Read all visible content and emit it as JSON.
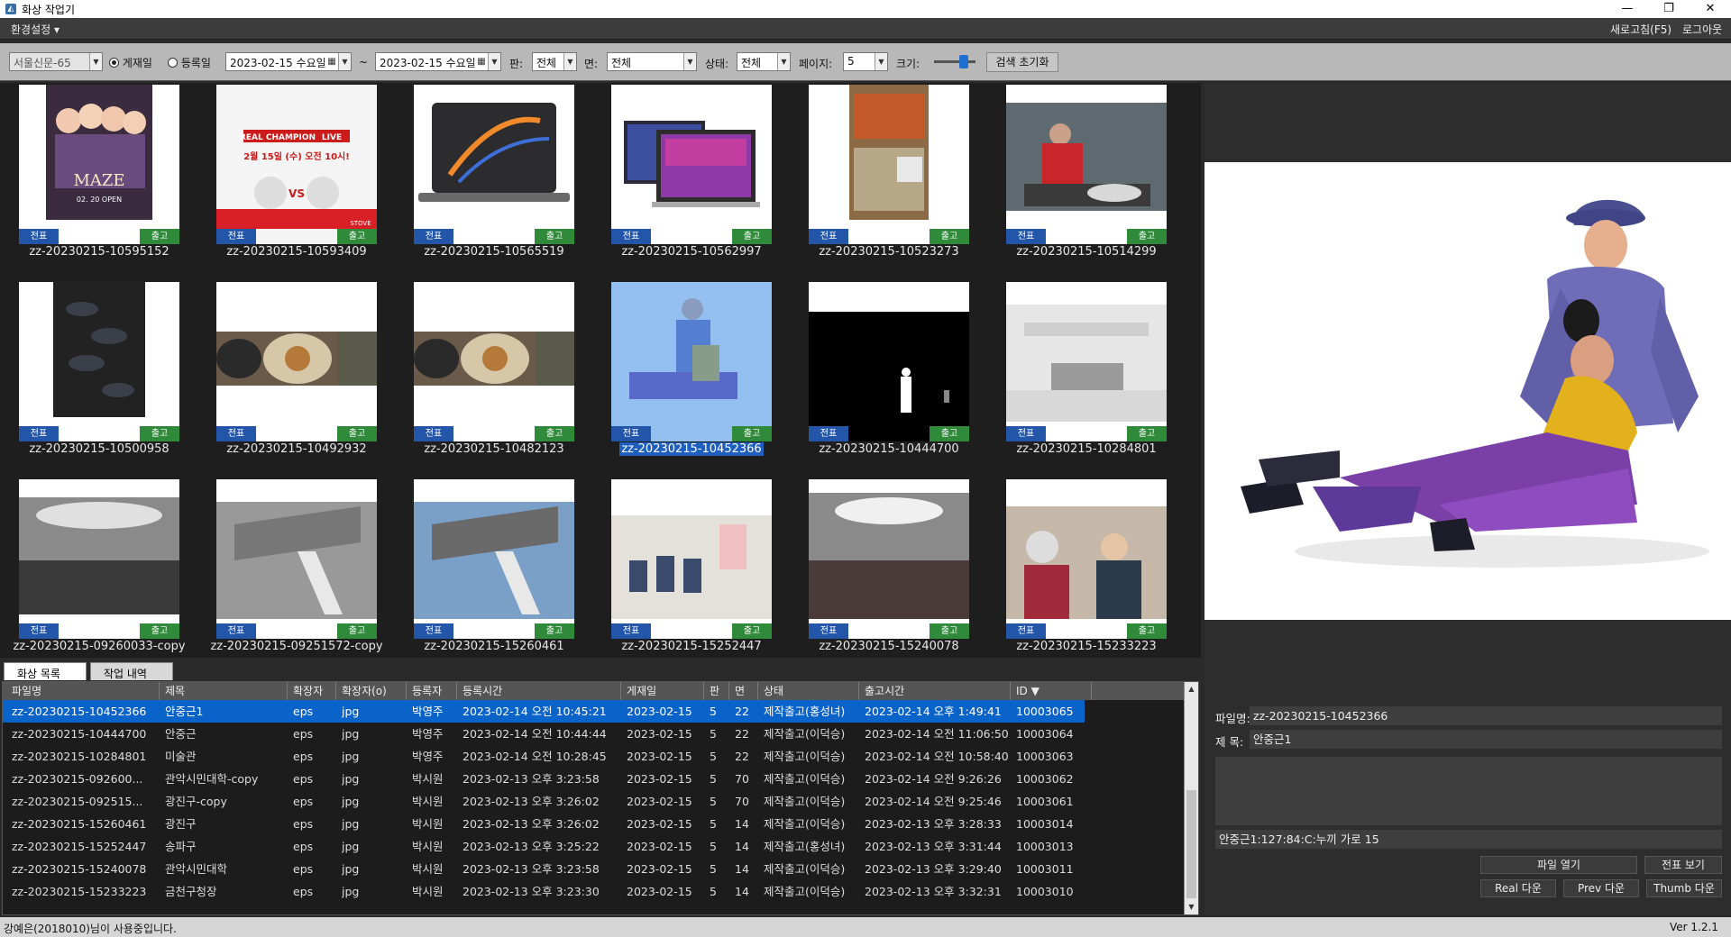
{
  "window": {
    "title": "화상 작업기",
    "controls": [
      "—",
      "❐",
      "✕"
    ]
  },
  "menubar": {
    "settings": "환경설정",
    "refresh": "새로고침(F5)",
    "logout": "로그아웃"
  },
  "toolbar": {
    "paper": "서울신문-65",
    "radio_publish": "게재일",
    "radio_register": "등록일",
    "date_from": "2023-02-15 수요일",
    "tilde": "~",
    "date_to": "2023-02-15 수요일",
    "pan_label": "판:",
    "pan_value": "전체",
    "myeon_label": "면:",
    "myeon_value": "전체",
    "status_label": "상태:",
    "status_value": "전체",
    "page_label": "페이지:",
    "page_value": "5",
    "size_label": "크기:",
    "size_level": 0.7,
    "reset": "검색 초기화"
  },
  "gallery": {
    "btn_jeonpyo": "전표",
    "btn_chulgo": "출고",
    "items": [
      "zz-20230215-10595152",
      "zz-20230215-10593409",
      "zz-20230215-10565519",
      "zz-20230215-10562997",
      "zz-20230215-10523273",
      "zz-20230215-10514299",
      "zz-20230215-10500958",
      "zz-20230215-10492932",
      "zz-20230215-10482123",
      "zz-20230215-10452366",
      "zz-20230215-10444700",
      "zz-20230215-10284801",
      "zz-20230215-09260033-copy",
      "zz-20230215-09251572-copy",
      "zz-20230215-15260461",
      "zz-20230215-15252447",
      "zz-20230215-15240078",
      "zz-20230215-15233223"
    ],
    "poster_text": {
      "title": "MAZE",
      "sub": "02. 20 OPEN",
      "live_title": "REAL CHAMPION",
      "live_tag": "LIVE",
      "live_date": "2월 15일 (수) 오전 10시!",
      "vs": "VS",
      "stove": "STOVE"
    }
  },
  "tabs": {
    "list": "화상 목록",
    "history": "작업 내역"
  },
  "table": {
    "headers": [
      "파일명",
      "제목",
      "확장자",
      "확장자(o)",
      "등록자",
      "등록시간",
      "게재일",
      "판",
      "면",
      "상태",
      "출고시간",
      "ID ▼"
    ],
    "rows": [
      [
        "zz-20230215-10452366",
        "안중근1",
        "eps",
        "jpg",
        "박영주",
        "2023-02-14 오전 10:45:21",
        "2023-02-15",
        "5",
        "22",
        "제작출고(홍성녀)",
        "2023-02-14 오후 1:49:41",
        "10003065"
      ],
      [
        "zz-20230215-10444700",
        "안중근",
        "eps",
        "jpg",
        "박영주",
        "2023-02-14 오전 10:44:44",
        "2023-02-15",
        "5",
        "22",
        "제작출고(이덕승)",
        "2023-02-14 오전 11:06:50",
        "10003064"
      ],
      [
        "zz-20230215-10284801",
        "미술관",
        "eps",
        "jpg",
        "박영주",
        "2023-02-14 오전 10:28:45",
        "2023-02-15",
        "5",
        "22",
        "제작출고(이덕승)",
        "2023-02-14 오전 10:58:40",
        "10003063"
      ],
      [
        "zz-20230215-092600...",
        "관악시민대학-copy",
        "eps",
        "jpg",
        "박시원",
        "2023-02-13 오후 3:23:58",
        "2023-02-15",
        "5",
        "70",
        "제작출고(이덕승)",
        "2023-02-14 오전 9:26:26",
        "10003062"
      ],
      [
        "zz-20230215-092515...",
        "광진구-copy",
        "eps",
        "jpg",
        "박시원",
        "2023-02-13 오후 3:26:02",
        "2023-02-15",
        "5",
        "70",
        "제작출고(이덕승)",
        "2023-02-14 오전 9:25:46",
        "10003061"
      ],
      [
        "zz-20230215-15260461",
        "광진구",
        "eps",
        "jpg",
        "박시원",
        "2023-02-13 오후 3:26:02",
        "2023-02-15",
        "5",
        "14",
        "제작출고(이덕승)",
        "2023-02-13 오후 3:28:33",
        "10003014"
      ],
      [
        "zz-20230215-15252447",
        "송파구",
        "eps",
        "jpg",
        "박시원",
        "2023-02-13 오후 3:25:22",
        "2023-02-15",
        "5",
        "14",
        "제작출고(홍성녀)",
        "2023-02-13 오후 3:31:44",
        "10003013"
      ],
      [
        "zz-20230215-15240078",
        "관악시민대학",
        "eps",
        "jpg",
        "박시원",
        "2023-02-13 오후 3:23:58",
        "2023-02-15",
        "5",
        "14",
        "제작출고(이덕승)",
        "2023-02-13 오후 3:29:40",
        "10003011"
      ],
      [
        "zz-20230215-15233223",
        "금천구청장",
        "eps",
        "jpg",
        "박시원",
        "2023-02-13 오후 3:23:30",
        "2023-02-15",
        "5",
        "14",
        "제작출고(이덕승)",
        "2023-02-13 오후 3:32:31",
        "10003010"
      ]
    ]
  },
  "detail": {
    "filename_label": "파일명:",
    "filename": "zz-20230215-10452366",
    "title_label": "제 목:",
    "title": "안중근1",
    "caption": "안중근1:127:84:C:누끼 가로 15",
    "open_file": "파일 열기",
    "view_slip": "전표 보기",
    "real_down": "Real 다운",
    "prev_down": "Prev 다운",
    "thumb_down": "Thumb 다운"
  },
  "statusbar": {
    "user": "강예은(2018010)님이 사용중입니다.",
    "version": "Ver 1.2.1"
  }
}
